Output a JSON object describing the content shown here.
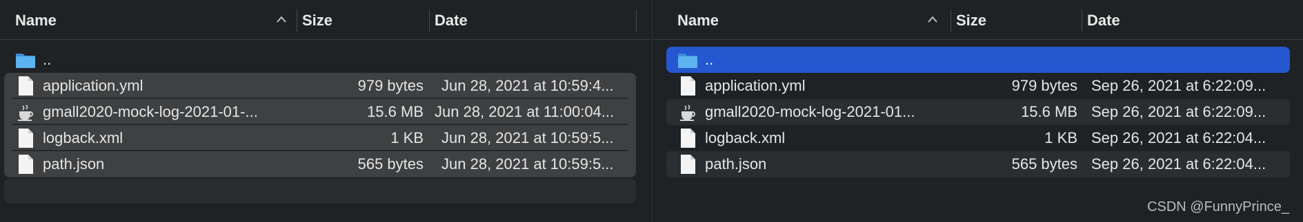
{
  "left_pane": {
    "columns": {
      "name": "Name",
      "size": "Size",
      "date": "Date"
    },
    "parent_label": "..",
    "rows": [
      {
        "name": "application.yml",
        "size": "979 bytes",
        "date": "Jun 28, 2021 at 10:59:4...",
        "icon": "document-icon"
      },
      {
        "name": "gmall2020-mock-log-2021-01-...",
        "size": "15.6 MB",
        "date": "Jun 28, 2021 at 11:00:04...",
        "icon": "java-jar-icon"
      },
      {
        "name": "logback.xml",
        "size": "1 KB",
        "date": "Jun 28, 2021 at 10:59:5...",
        "icon": "document-icon"
      },
      {
        "name": "path.json",
        "size": "565 bytes",
        "date": "Jun 28, 2021 at 10:59:5...",
        "icon": "document-icon"
      }
    ]
  },
  "right_pane": {
    "columns": {
      "name": "Name",
      "size": "Size",
      "date": "Date"
    },
    "parent_label": "..",
    "rows": [
      {
        "name": "application.yml",
        "size": "979 bytes",
        "date": "Sep 26, 2021 at 6:22:09...",
        "icon": "document-icon"
      },
      {
        "name": "gmall2020-mock-log-2021-01...",
        "size": "15.6 MB",
        "date": "Sep 26, 2021 at 6:22:09...",
        "icon": "java-jar-icon"
      },
      {
        "name": "logback.xml",
        "size": "1 KB",
        "date": "Sep 26, 2021 at 6:22:04...",
        "icon": "document-icon"
      },
      {
        "name": "path.json",
        "size": "565 bytes",
        "date": "Sep 26, 2021 at 6:22:04...",
        "icon": "document-icon"
      }
    ]
  },
  "colors": {
    "selection": "#2558d0",
    "background": "#1f2224",
    "folder": "#4aa8e8"
  },
  "watermark": "CSDN @FunnyPrince_"
}
